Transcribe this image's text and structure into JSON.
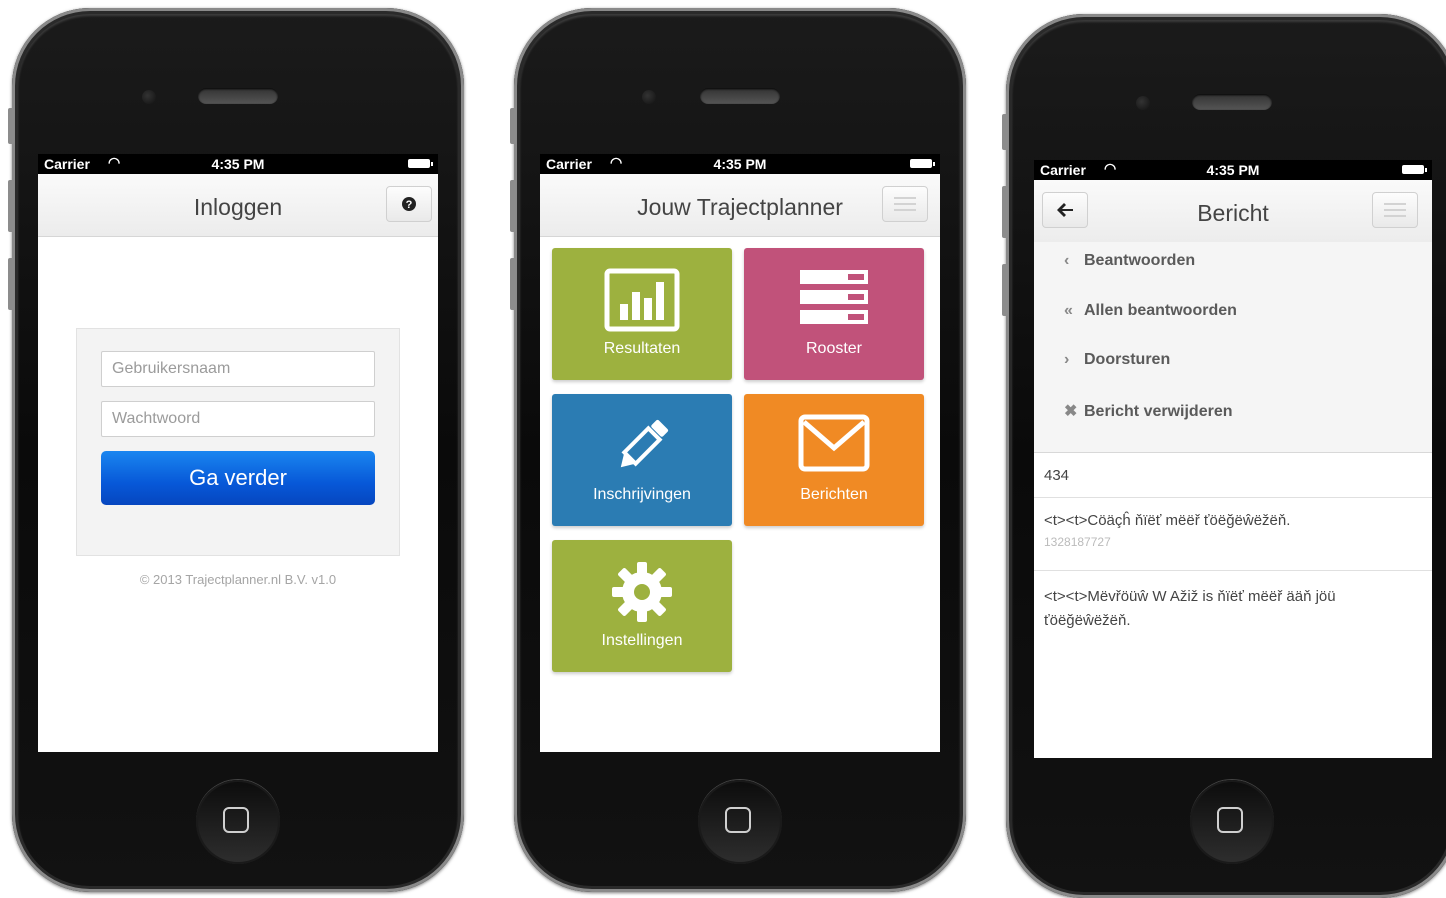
{
  "status_bar": {
    "carrier": "Carrier",
    "time": "4:35 PM"
  },
  "login": {
    "title": "Inloggen",
    "help_icon": "help-icon",
    "username_placeholder": "Gebruikersnaam",
    "password_placeholder": "Wachtwoord",
    "submit_label": "Ga verder",
    "copyright": "© 2013 Trajectplanner.nl B.V. v1.0"
  },
  "dashboard": {
    "title": "Jouw Trajectplanner",
    "tiles": [
      {
        "label": "Resultaten",
        "icon": "bar-chart-icon",
        "color": "#9db13f"
      },
      {
        "label": "Rooster",
        "icon": "server-icon",
        "color": "#c1527a"
      },
      {
        "label": "Inschrijvingen",
        "icon": "pencil-icon",
        "color": "#2b7cb3"
      },
      {
        "label": "Berichten",
        "icon": "envelope-icon",
        "color": "#f08a24"
      },
      {
        "label": "Instellingen",
        "icon": "gear-icon",
        "color": "#9db13f"
      }
    ]
  },
  "message": {
    "title": "Bericht",
    "actions": [
      {
        "icon": "‹",
        "label": "Beantwoorden"
      },
      {
        "icon": "«",
        "label": "Allen beantwoorden"
      },
      {
        "icon": "›",
        "label": "Doorsturen"
      },
      {
        "icon": "✖",
        "label": "Bericht verwijderen"
      }
    ],
    "id": "434",
    "rows": [
      {
        "text": "<t><t>Cöäçĥ ňïëť mëëř ťöëğëŵëžëň.",
        "sub": "1328187727"
      },
      {
        "text": "<t><t>Mëvřöüŵ W Ažiž is ňïëť mëëř ääň jöü ťöëğëŵëžëň.",
        "sub": ""
      }
    ]
  }
}
